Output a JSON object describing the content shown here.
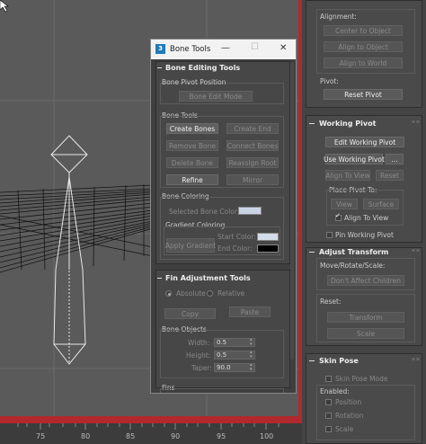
{
  "ruler": {
    "labels": [
      "75",
      "80",
      "85",
      "90",
      "95",
      "100"
    ]
  },
  "command_panel": {
    "alignment": {
      "label": "Alignment:",
      "center_to_object": "Center to Object",
      "align_to_object": "Align to Object",
      "align_to_world": "Align to World"
    },
    "pivot": {
      "label": "Pivot:",
      "reset_pivot": "Reset Pivot"
    },
    "working_pivot": {
      "title": "Working Pivot",
      "edit_working_pivot": "Edit Working Pivot",
      "use_working_pivot": "Use Working Pivot",
      "more": "...",
      "align_to_view": "Align To View",
      "reset": "Reset",
      "place_pivot_to": "Place Pivot To:",
      "view": "View",
      "surface": "Surface",
      "align_to_view_check": "Align To View",
      "pin_working_pivot": "Pin Working Pivot"
    },
    "adjust_transform": {
      "title": "Adjust Transform",
      "move_label": "Move/Rotate/Scale:",
      "dont_affect_children": "Don't Affect Children",
      "reset_label": "Reset:",
      "transform": "Transform",
      "scale": "Scale"
    },
    "skin_pose": {
      "title": "Skin Pose",
      "skin_pose_mode": "Skin Pose Mode",
      "enabled": "Enabled:",
      "position": "Position",
      "rotation": "Rotation",
      "scale": "Scale"
    }
  },
  "bone_tools": {
    "logo": "3",
    "title": "Bone Tools",
    "controls": {
      "minimize": "—",
      "maximize": "☐",
      "close": "✕"
    },
    "bone_editing_tools": {
      "title": "Bone Editing Tools",
      "bone_pivot_position": "Bone Pivot Position",
      "bone_edit_mode": "Bone Edit Mode",
      "bone_tools_label": "Bone Tools",
      "create_bones": "Create Bones",
      "create_end": "Create End",
      "remove_bone": "Remove Bone",
      "connect_bones": "Connect Bones",
      "delete_bone": "Delete Bone",
      "reassign_root": "Reassign Root",
      "refine": "Refine",
      "mirror": "Mirror",
      "bone_coloring": "Bone Coloring",
      "selected_bone_color": "Selected Bone Color:",
      "gradient_coloring": "Gradient Coloring",
      "apply_gradient": "Apply Gradient",
      "start_color": "Start Color:",
      "end_color": "End Color:",
      "colors": {
        "selected": "#c9d3e6",
        "start": "#d4dcea",
        "end": "#000000"
      }
    },
    "fin_adjustment": {
      "title": "Fin Adjustment Tools",
      "absolute": "Absolute",
      "relative": "Relative",
      "copy": "Copy",
      "paste": "Paste",
      "bone_objects": "Bone Objects",
      "width_label": "Width:",
      "width_value": "0.5",
      "height_label": "Height:",
      "height_value": "0.5",
      "taper_label": "Taper:",
      "taper_value": "90.0",
      "fins_label": "Fins"
    }
  },
  "colors": {
    "accent_red": "#b1282d"
  }
}
